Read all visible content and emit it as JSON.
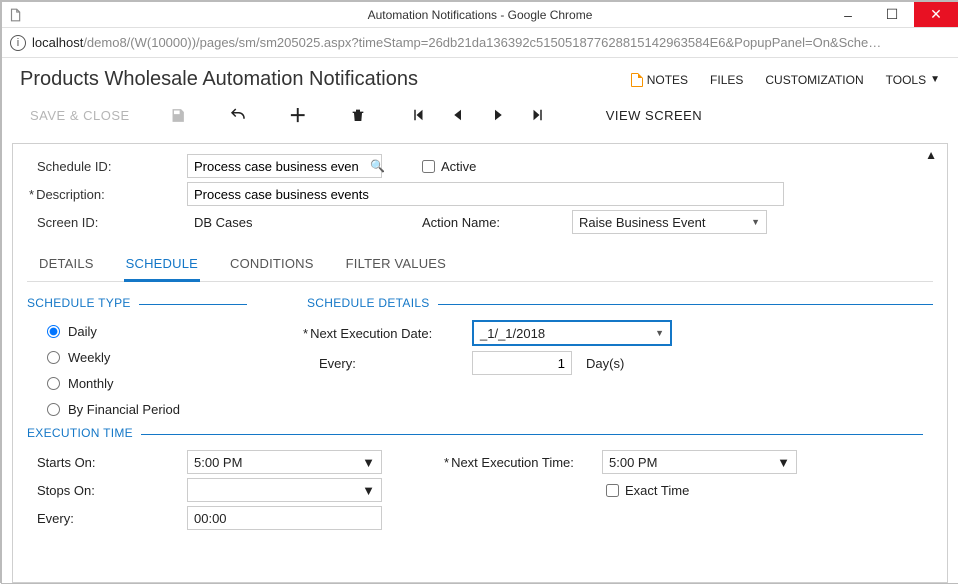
{
  "window": {
    "title": "Automation Notifications - Google Chrome"
  },
  "url": {
    "host": "localhost",
    "path": "/demo8/(W(10000))/pages/sm/sm205025.aspx?timeStamp=26db21da136392c515051877628815142963584E6&PopupPanel=On&Sche…"
  },
  "header": {
    "title": "Products Wholesale  Automation Notifications",
    "actions": {
      "notes": "NOTES",
      "files": "FILES",
      "customization": "CUSTOMIZATION",
      "tools": "TOOLS"
    }
  },
  "toolbar": {
    "save_close": "SAVE & CLOSE",
    "view_screen": "VIEW SCREEN"
  },
  "form": {
    "schedule_id_label": "Schedule ID:",
    "schedule_id_value": "Process case business even",
    "active_label": "Active",
    "active_checked": false,
    "description_label": "Description:",
    "description_value": "Process case business events",
    "screen_id_label": "Screen ID:",
    "screen_id_value": "DB Cases",
    "action_name_label": "Action Name:",
    "action_name_value": "Raise Business Event"
  },
  "tabs": {
    "details": "DETAILS",
    "schedule": "SCHEDULE",
    "conditions": "CONDITIONS",
    "filter_values": "FILTER VALUES",
    "active_index": 1
  },
  "schedule_type": {
    "title": "SCHEDULE TYPE",
    "options": {
      "daily": "Daily",
      "weekly": "Weekly",
      "monthly": "Monthly",
      "by_financial": "By Financial Period"
    },
    "selected": "daily"
  },
  "schedule_details": {
    "title": "SCHEDULE DETAILS",
    "next_exec_date_label": "Next Execution Date:",
    "next_exec_date_value": "_1/_1/2018",
    "every_label": "Every:",
    "every_value": "1",
    "every_unit": "Day(s)"
  },
  "execution_time": {
    "title": "EXECUTION TIME",
    "starts_on_label": "Starts On:",
    "starts_on_value": "5:00 PM",
    "stops_on_label": "Stops On:",
    "stops_on_value": "",
    "every_label": "Every:",
    "every_value": "00:00",
    "next_exec_time_label": "Next Execution Time:",
    "next_exec_time_value": "5:00 PM",
    "exact_time_label": "Exact Time",
    "exact_time_checked": false
  }
}
